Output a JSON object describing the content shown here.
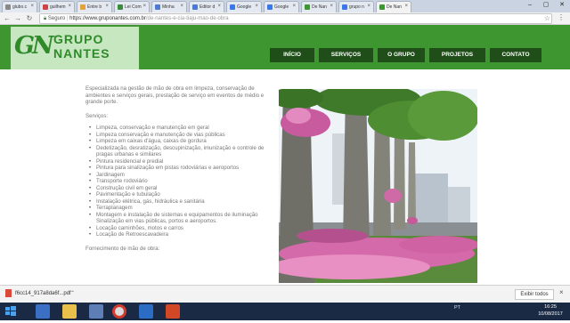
{
  "browser": {
    "tabs": [
      {
        "label": "glubo.c"
      },
      {
        "label": "guilhem"
      },
      {
        "label": "Entre b"
      },
      {
        "label": "Lei Com"
      },
      {
        "label": "Minha"
      },
      {
        "label": "Editor d"
      },
      {
        "label": "Google"
      },
      {
        "label": "Google"
      },
      {
        "label": "De Nan"
      },
      {
        "label": "grupo n"
      },
      {
        "label": "De Nan"
      }
    ],
    "secure_label": "Seguro",
    "url_domain": "https://www.gruponantes.com.br",
    "url_path": "/de-nantes-e-cia-tiaju-mao-de-obra"
  },
  "site": {
    "logo": {
      "mark": "GN",
      "line1": "GRUPO",
      "line2": "NANTES"
    },
    "nav": [
      "INÍCIO",
      "SERVIÇOS",
      "O GRUPO",
      "PROJETOS",
      "CONTATO"
    ],
    "intro": "Especializada na gestão de mão de obra em limpeza, conservação de ambientes e serviços gerais, prestação de serviço em eventos de médio e grande porte.",
    "services_title": "Serviços:",
    "services": [
      "Limpeza, conservação e manutenção em geral",
      "Limpeza conservação e manutenção de vias públicas",
      "Limpeza em caixas d'água, caixas de gordura",
      "Dedetização, desratização, descupinização, imunização e controle de pragas urbanas e similares",
      "Pintura residencial e predial",
      "Pintura para sinalização em pistas rodoviárias e aeroportos",
      "Jardinagem",
      "Transporte rodoviário",
      "Construção civil em geral",
      "Pavimentação e tubulação",
      "Instalação elétrica, gás, hidráulica e sanitária",
      "Terraplanagem",
      "Montagem e instalação de sistemas e equipamentos de iluminação Sinalização em vias públicas, portos e aeroportos.",
      "Locação caminhões, motos e carros",
      "Locação de Retroescavadeira"
    ],
    "labor_title": "Fornecimento de mão de obra:"
  },
  "downloads": {
    "file_name": "f6cc14_917a8da6f...pdf",
    "show_all": "Exibir todos"
  },
  "taskbar": {
    "tray_label": "PT",
    "time": "16:25",
    "date": "10/08/2017"
  },
  "colors": {
    "header_green": "#3d9630",
    "nav_dark_green": "#1f4e19",
    "logo_bg": "#c6e7c0"
  }
}
